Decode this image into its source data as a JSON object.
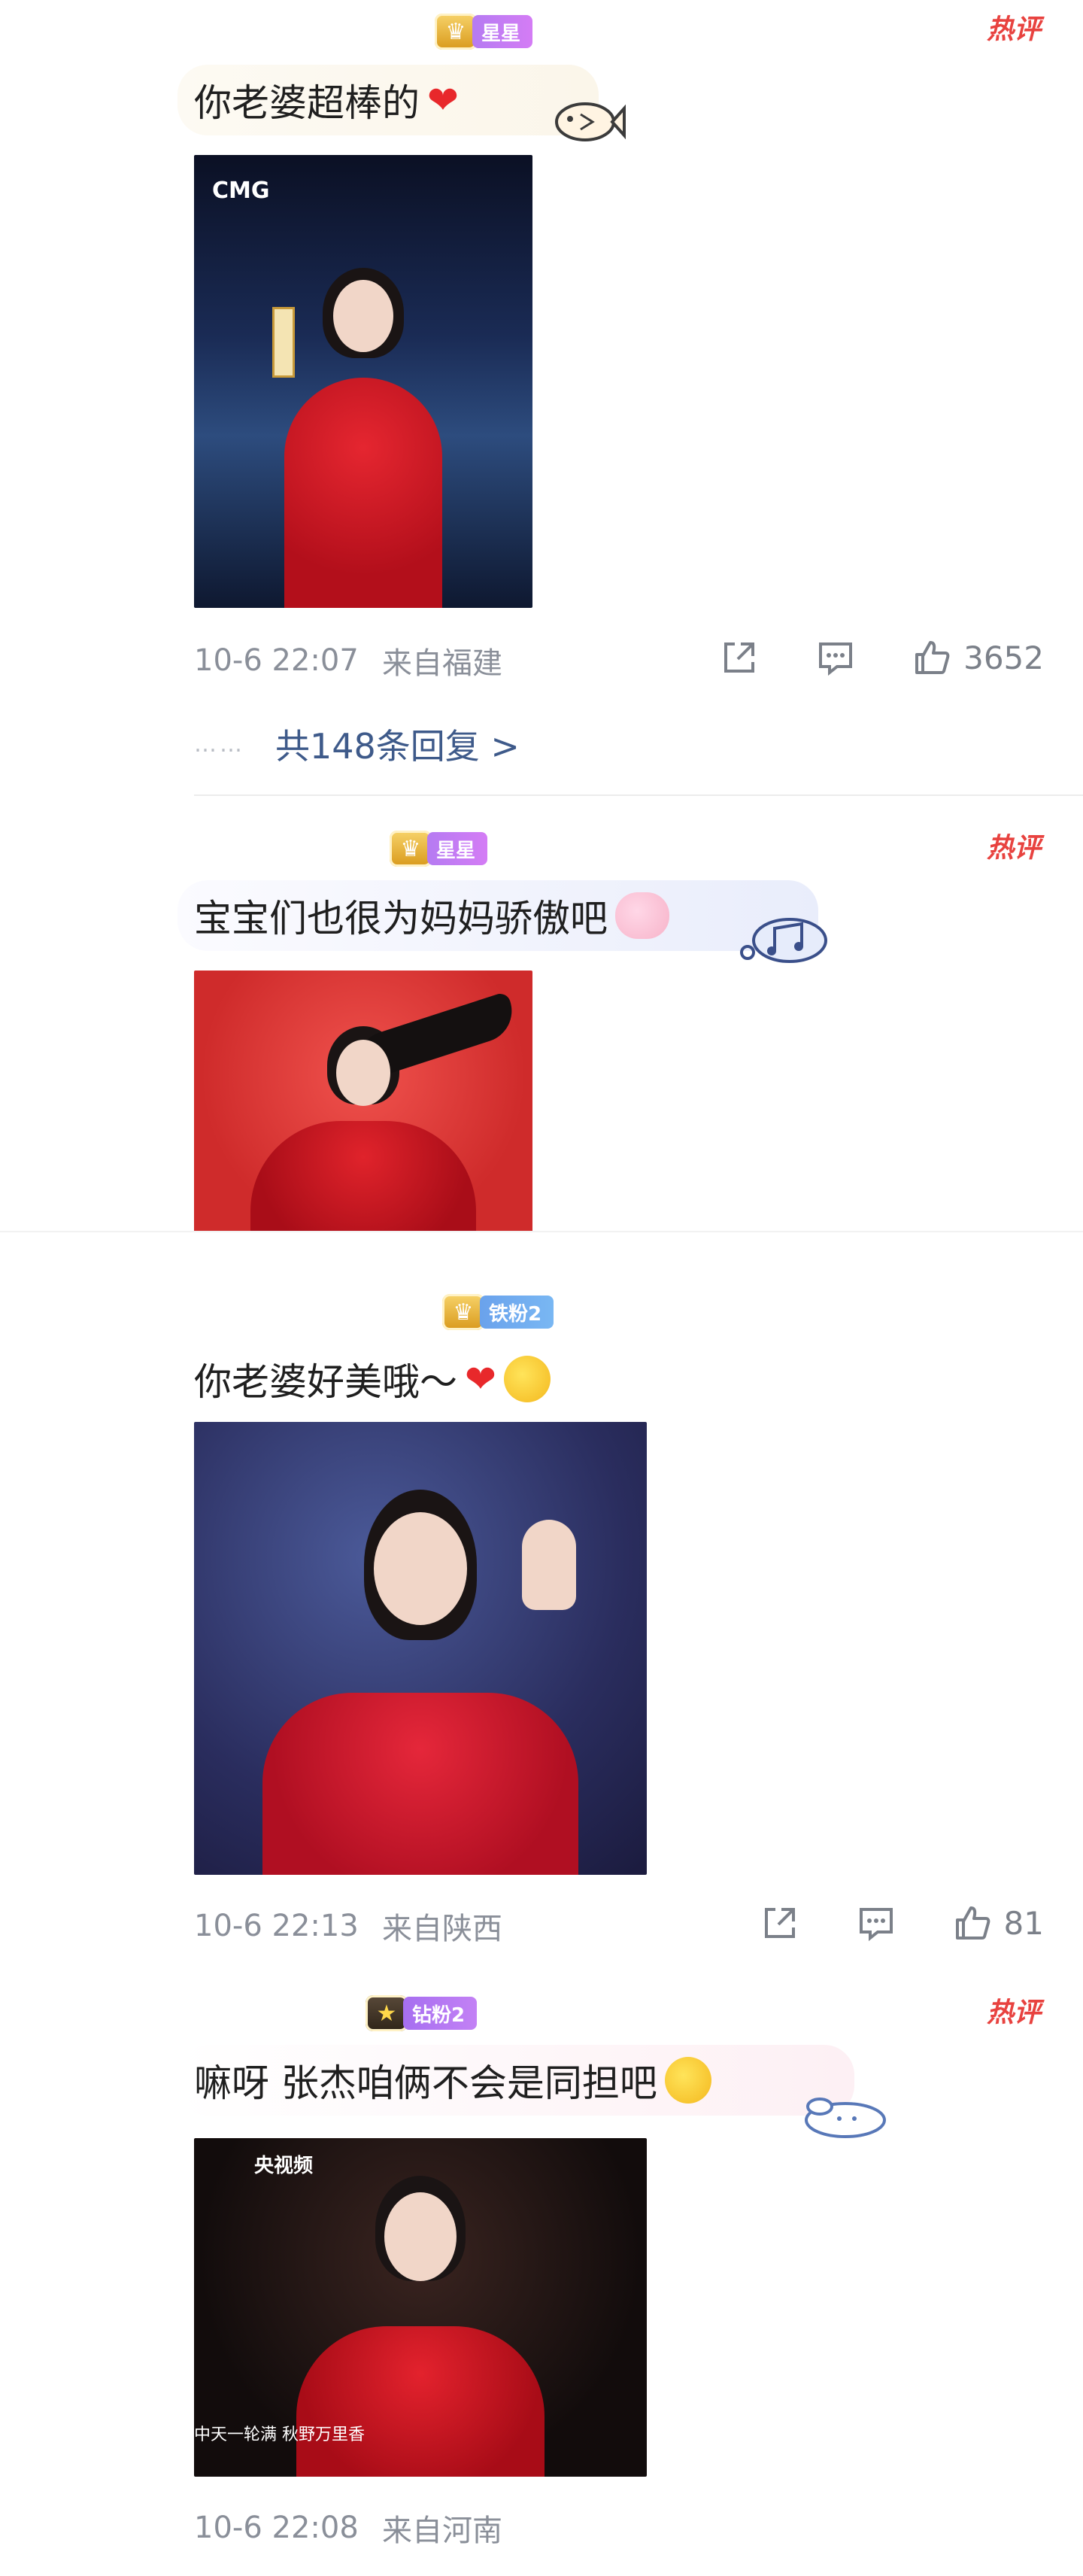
{
  "comments": [
    {
      "badge": "星星",
      "badge_icon": "crown-icon",
      "hot_tag": "热评",
      "text": "你老婆超棒的",
      "heart": "❤",
      "photo_text": "CMG",
      "date": "10-6 22:07",
      "location": "来自福建",
      "likes": "3652",
      "replies_dots": "……",
      "replies": "共148条回复 >"
    },
    {
      "badge": "星星",
      "badge_icon": "crown-icon",
      "hot_tag": "热评",
      "text": "宝宝们也很为妈妈骄傲吧"
    },
    {
      "badge": "铁粉2",
      "badge_icon": "crown-icon",
      "text": "你老婆好美哦～",
      "heart": "❤",
      "date": "10-6 22:13",
      "location": "来自陕西",
      "likes": "81"
    },
    {
      "badge": "钻粉2",
      "badge_icon": "star-crown-icon",
      "hot_tag": "热评",
      "text": "嘛呀 张杰咱俩不会是同担吧",
      "photo_text": "央视频",
      "photo_caption": "中天一轮满 秋野万里香",
      "date": "10-6 22:08",
      "location": "来自河南"
    }
  ],
  "colors": {
    "hot": "#e8423f",
    "meta": "#8a8f99",
    "replies": "#3e5a8a",
    "dress": "#c8121e"
  }
}
